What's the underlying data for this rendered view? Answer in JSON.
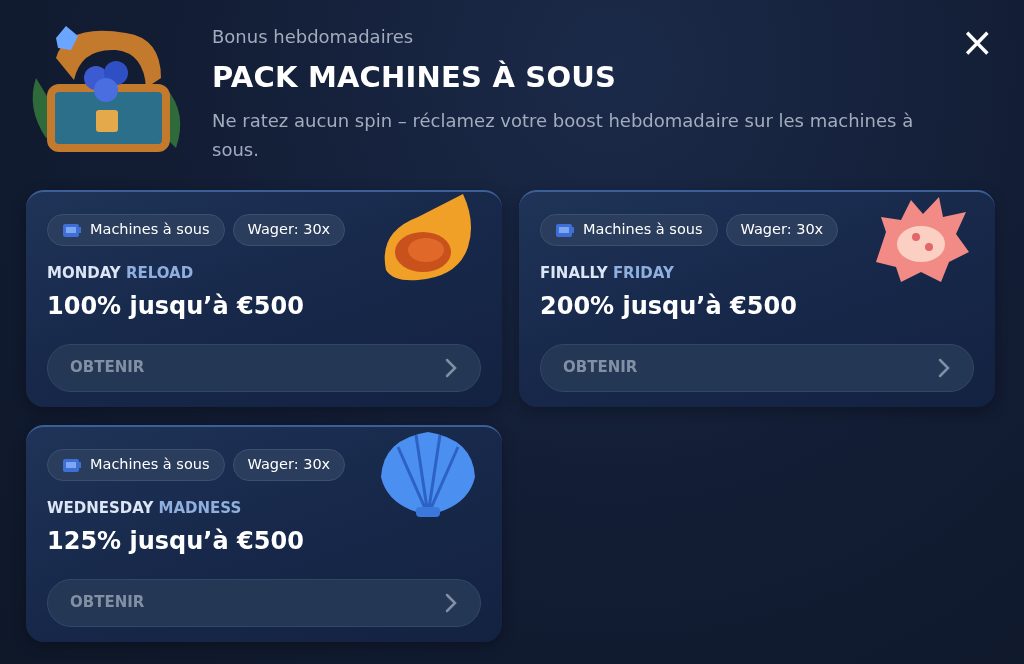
{
  "header": {
    "eyebrow": "Bonus hebdomadaires",
    "title": "PACK MACHINES À SOUS",
    "description": "Ne ratez aucun spin – réclamez votre boost hebdomadaire sur les machines à sous.",
    "close": "×"
  },
  "offers": [
    {
      "kind": "conch",
      "category": "Machines à sous",
      "wager": "Wager: 30x",
      "name_lead": "MONDAY",
      "name_rest": "RELOAD",
      "amount": "100% jusqu’à €500",
      "action": "OBTENIR"
    },
    {
      "kind": "spiky",
      "category": "Machines à sous",
      "wager": "Wager: 30x",
      "name_lead": "FINALLY",
      "name_rest": "FRIDAY",
      "amount": "200% jusqu’à €500",
      "action": "OBTENIR"
    },
    {
      "kind": "scallop",
      "category": "Machines à sous",
      "wager": "Wager: 30x",
      "name_lead": "WEDNESDAY",
      "name_rest": "MADNESS",
      "amount": "125% jusqu’à €500",
      "action": "OBTENIR"
    }
  ]
}
